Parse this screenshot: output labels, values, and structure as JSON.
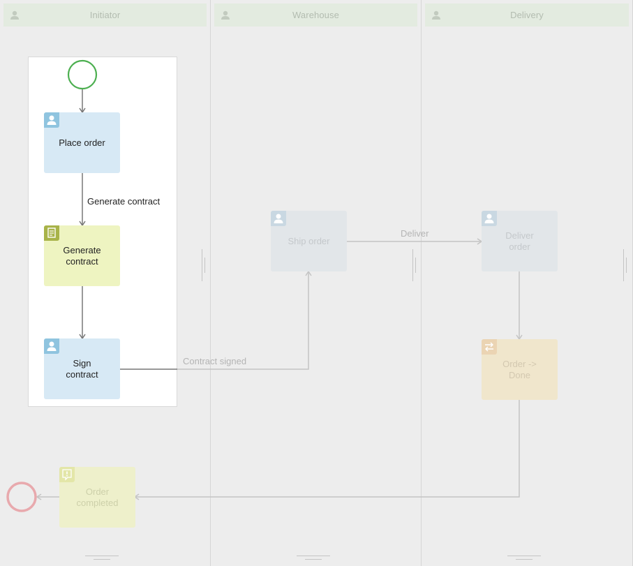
{
  "lanes": [
    {
      "title": "Initiator",
      "icon": "person-icon"
    },
    {
      "title": "Warehouse",
      "icon": "person-icon"
    },
    {
      "title": "Delivery",
      "icon": "person-icon"
    }
  ],
  "nodes": {
    "place_order": {
      "label": "Place order",
      "icon": "person-icon"
    },
    "generate_contract": {
      "label": "Generate\ncontract",
      "icon": "document-icon"
    },
    "sign_contract": {
      "label": "Sign\ncontract",
      "icon": "person-icon"
    },
    "ship_order": {
      "label": "Ship order",
      "icon": "person-icon"
    },
    "deliver_order": {
      "label": "Deliver\norder",
      "icon": "person-icon"
    },
    "order_done": {
      "label": "Order ->\nDone",
      "icon": "swap-arrows-icon"
    },
    "order_completed": {
      "label": "Order\ncompleted",
      "icon": "exclamation-icon"
    }
  },
  "edges": {
    "generate_contract": "Generate contract",
    "contract_signed": "Contract signed",
    "deliver": "Deliver"
  },
  "colors": {
    "start_event": "#4caf50",
    "end_event": "#e8a9ad",
    "user_task": "#d7e9f5",
    "document_task": "#eef4c1",
    "lane_header": "#e3ebe0"
  }
}
